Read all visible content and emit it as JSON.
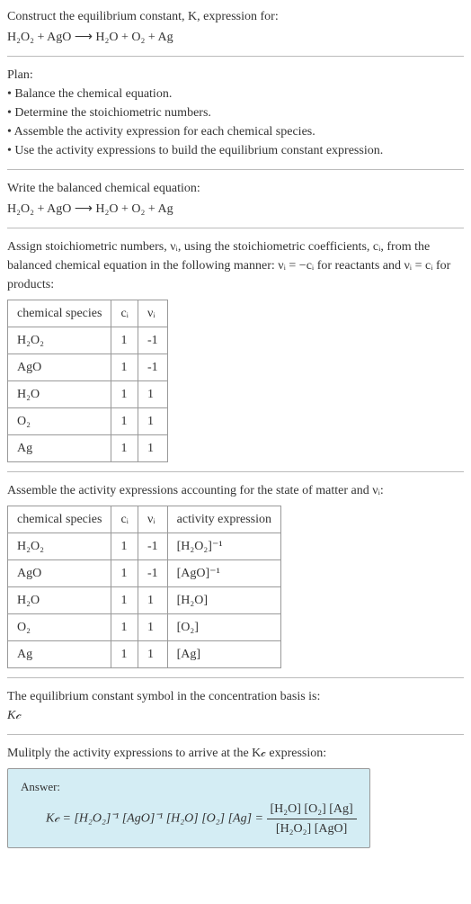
{
  "intro": {
    "line1": "Construct the equilibrium constant, K, expression for:",
    "equation": "H₂O₂ + AgO ⟶ H₂O + O₂ + Ag"
  },
  "plan": {
    "heading": "Plan:",
    "items": [
      "Balance the chemical equation.",
      "Determine the stoichiometric numbers.",
      "Assemble the activity expression for each chemical species.",
      "Use the activity expressions to build the equilibrium constant expression."
    ]
  },
  "balanced": {
    "heading": "Write the balanced chemical equation:",
    "equation": "H₂O₂ + AgO ⟶ H₂O + O₂ + Ag"
  },
  "stoich": {
    "heading_part1": "Assign stoichiometric numbers, νᵢ, using the stoichiometric coefficients, cᵢ, from the balanced chemical equation in the following manner: νᵢ = −cᵢ for reactants and νᵢ = cᵢ for products:",
    "headers": [
      "chemical species",
      "cᵢ",
      "νᵢ"
    ],
    "rows": [
      {
        "species": "H₂O₂",
        "c": "1",
        "v": "-1"
      },
      {
        "species": "AgO",
        "c": "1",
        "v": "-1"
      },
      {
        "species": "H₂O",
        "c": "1",
        "v": "1"
      },
      {
        "species": "O₂",
        "c": "1",
        "v": "1"
      },
      {
        "species": "Ag",
        "c": "1",
        "v": "1"
      }
    ]
  },
  "activity": {
    "heading": "Assemble the activity expressions accounting for the state of matter and νᵢ:",
    "headers": [
      "chemical species",
      "cᵢ",
      "νᵢ",
      "activity expression"
    ],
    "rows": [
      {
        "species": "H₂O₂",
        "c": "1",
        "v": "-1",
        "expr": "[H₂O₂]⁻¹"
      },
      {
        "species": "AgO",
        "c": "1",
        "v": "-1",
        "expr": "[AgO]⁻¹"
      },
      {
        "species": "H₂O",
        "c": "1",
        "v": "1",
        "expr": "[H₂O]"
      },
      {
        "species": "O₂",
        "c": "1",
        "v": "1",
        "expr": "[O₂]"
      },
      {
        "species": "Ag",
        "c": "1",
        "v": "1",
        "expr": "[Ag]"
      }
    ]
  },
  "symbol": {
    "line1": "The equilibrium constant symbol in the concentration basis is:",
    "line2": "K𝒸"
  },
  "multiply": {
    "heading": "Mulitply the activity expressions to arrive at the K𝒸 expression:"
  },
  "answer": {
    "label": "Answer:",
    "lhs": "K𝒸 = [H₂O₂]⁻¹ [AgO]⁻¹ [H₂O] [O₂] [Ag] = ",
    "num": "[H₂O] [O₂] [Ag]",
    "den": "[H₂O₂] [AgO]"
  },
  "chart_data": {
    "type": "table",
    "tables": [
      {
        "title": "Stoichiometric numbers",
        "columns": [
          "chemical species",
          "cᵢ",
          "νᵢ"
        ],
        "rows": [
          [
            "H₂O₂",
            1,
            -1
          ],
          [
            "AgO",
            1,
            -1
          ],
          [
            "H₂O",
            1,
            1
          ],
          [
            "O₂",
            1,
            1
          ],
          [
            "Ag",
            1,
            1
          ]
        ]
      },
      {
        "title": "Activity expressions",
        "columns": [
          "chemical species",
          "cᵢ",
          "νᵢ",
          "activity expression"
        ],
        "rows": [
          [
            "H₂O₂",
            1,
            -1,
            "[H₂O₂]⁻¹"
          ],
          [
            "AgO",
            1,
            -1,
            "[AgO]⁻¹"
          ],
          [
            "H₂O",
            1,
            1,
            "[H₂O]"
          ],
          [
            "O₂",
            1,
            1,
            "[O₂]"
          ],
          [
            "Ag",
            1,
            1,
            "[Ag]"
          ]
        ]
      }
    ]
  }
}
